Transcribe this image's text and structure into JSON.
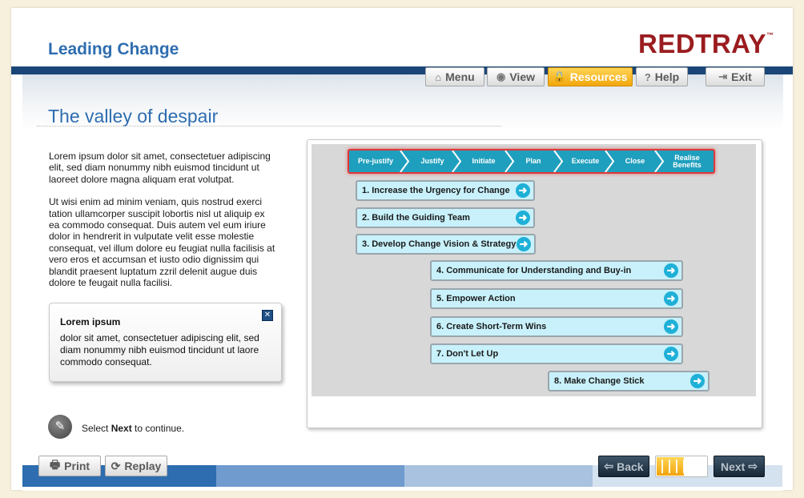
{
  "header": {
    "course_title": "Leading Change",
    "brand": "REDTRAY",
    "brand_tm": "™"
  },
  "nav": {
    "menu": "Menu",
    "view": "View",
    "resources": "Resources",
    "help": "Help",
    "exit": "Exit",
    "active": "Resources"
  },
  "page": {
    "title": "The valley of despair",
    "paragraphs": [
      "Lorem ipsum dolor sit amet, consectetuer adipiscing elit, sed diam nonummy nibh euismod tincidunt ut laoreet dolore magna aliquam erat volutpat.",
      "Ut wisi enim ad minim veniam, quis nostrud exerci tation ullamcorper suscipit lobortis nisl ut aliquip ex ea commodo consequat. Duis autem vel eum iriure dolor in hendrerit in vulputate velit esse molestie consequat, vel illum dolore eu feugiat nulla facilisis at vero eros et accumsan et iusto odio dignissim qui blandit praesent luptatum zzril delenit augue duis dolore te feugait nulla facilisi."
    ]
  },
  "popup": {
    "title": "Lorem ipsum",
    "text": "dolor sit amet, consectetuer adipiscing elit, sed diam nonummy nibh euismod tincidunt ut laore commodo consequat."
  },
  "instruction": {
    "prefix": "Select ",
    "bold": "Next",
    "suffix": " to continue."
  },
  "diagram": {
    "phases": [
      "Pre-justify",
      "Justify",
      "Initiate",
      "Plan",
      "Execute",
      "Close",
      "Realise Benefits"
    ],
    "steps": [
      "1. Increase the Urgency for Change",
      "2. Build the Guiding Team",
      "3. Develop Change Vision & Strategy",
      "4. Communicate for Understanding and Buy-in",
      "5. Empower Action",
      "6. Create Short-Term Wins",
      "7. Don't Let Up",
      "8. Make Change Stick"
    ]
  },
  "footer": {
    "print": "Print",
    "replay": "Replay",
    "back": "Back",
    "next": "Next",
    "progress_fraction": 0.55
  },
  "colors": {
    "accent_blue": "#2e6db0",
    "brand_red": "#9b1c1f",
    "active_orange": "#f2a70c",
    "phase_teal": "#1f9fbe",
    "step_fill": "#c8f1fb"
  }
}
